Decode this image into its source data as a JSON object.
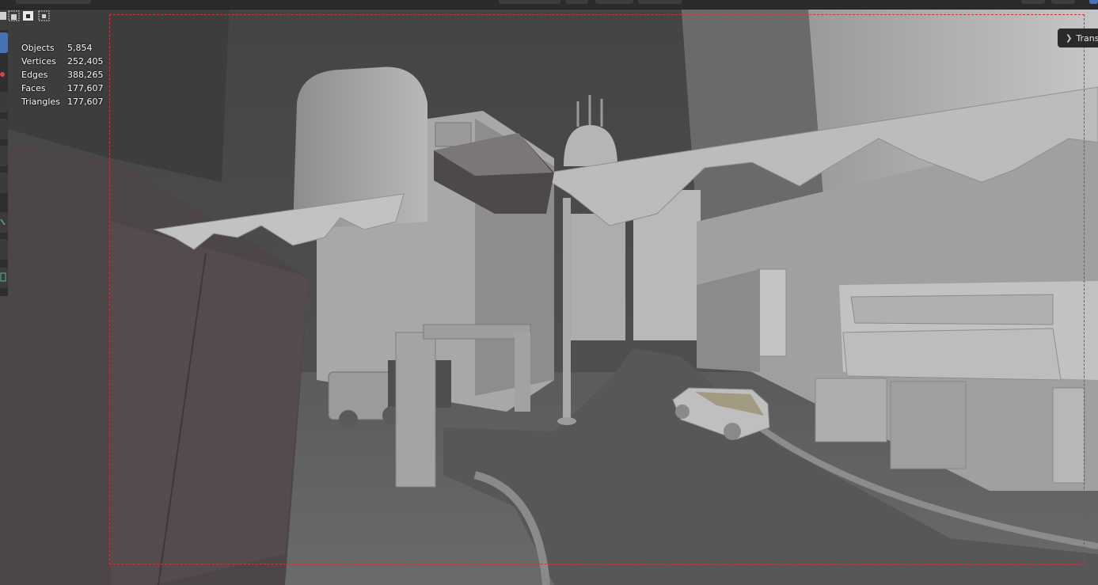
{
  "overlay_stats": [
    {
      "label": "Objects",
      "value": "5,854"
    },
    {
      "label": "Vertices",
      "value": "252,405"
    },
    {
      "label": "Edges",
      "value": "388,265"
    },
    {
      "label": "Faces",
      "value": "177,607"
    },
    {
      "label": "Triangles",
      "value": "177,607"
    }
  ],
  "sidebar_tab": {
    "label": "Trans",
    "icon": "chevron-right-icon"
  },
  "colors": {
    "camera_frame": "#c9353a",
    "active_tool": "#4772b3",
    "sky": "#4a4a4a",
    "ground": "#636363"
  }
}
